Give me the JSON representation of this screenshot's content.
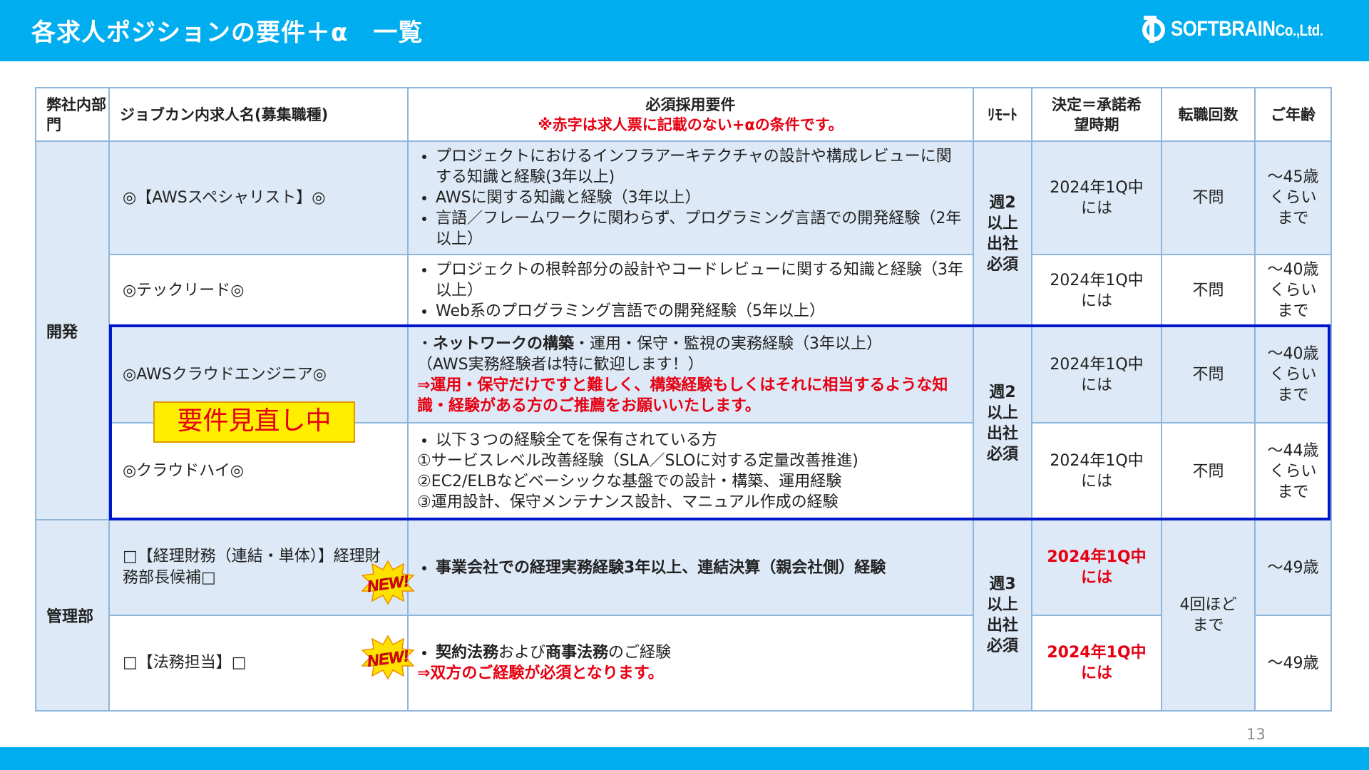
{
  "header": {
    "title": "各求人ポジションの要件＋α　一覧",
    "logo_text": "SOFTBRAIN",
    "logo_suffix": "Co.,Ltd."
  },
  "colors": {
    "brand": "#00aeef",
    "accent_red": "#e60012",
    "highlight_box": "#0018cc",
    "badge_yellow": "#ffee00",
    "row_blue": "#dde9f6"
  },
  "columns": {
    "dept": "弊社内部門",
    "job": "ジョブカン内求人名(募集職種)",
    "req_title": "必須採用要件",
    "req_note": "※赤字は求人票に記載のない+αの条件です。",
    "remote": "ﾘﾓｰﾄ",
    "timing": "決定＝承諾希望時期",
    "changes": "転職回数",
    "age": "ご年齢"
  },
  "depts": {
    "dev": "開発",
    "admin": "管理部"
  },
  "remote": {
    "g1": "週2以上出社必須",
    "g2": "週2以上出社必須",
    "g3": "週3以上出社必須"
  },
  "rows": [
    {
      "job": "◎【AWSスペシャリスト】◎",
      "req": [
        "プロジェクトにおけるインフラアーキテクチャの設計や構成レビューに関する知識と経験(3年以上)",
        "AWSに関する知識と経験（3年以上）",
        "言語／フレームワークに関わらず、プログラミング言語での開発経験（2年以上）"
      ],
      "timing": "2024年1Q中には",
      "changes": "不問",
      "age": "～45歳くらいまで"
    },
    {
      "job": "◎テックリード◎",
      "req": [
        "プロジェクトの根幹部分の設計やコードレビューに関する知識と経験（3年以上）",
        "Web系のプログラミング言語での開発経験（5年以上）"
      ],
      "timing": "2024年1Q中には",
      "changes": "不問",
      "age": "～40歳くらいまで"
    },
    {
      "job": "◎AWSクラウドエンジニア◎",
      "req_prefix": "・",
      "req_bold": "ネットワークの構築",
      "req_rest": "・運用・保守・監視の実務経験（3年以上）",
      "req_line2": "（AWS実務経験者は特に歓迎します！）",
      "req_red": "⇒運用・保守だけですと難しく、構築経験もしくはそれに相当するような知識・経験がある方のご推薦をお願いいたします。",
      "timing": "2024年1Q中には",
      "changes": "不問",
      "age": "～40歳くらいまで"
    },
    {
      "job": "◎クラウドハイ◎",
      "req_bullet": "以下３つの経験全てを保有されている方",
      "req_lines": [
        "①サービスレベル改善経験（SLA／SLOに対する定量改善推進)",
        "②EC2/ELBなどベーシックな基盤での設計・構築、運用経験",
        "③運用設計、保守メンテナンス設計、マニュアル作成の経験"
      ],
      "timing": "2024年1Q中には",
      "changes": "不問",
      "age": "～44歳くらいまで"
    },
    {
      "job": "□【経理財務（連結・単体）】経理財務部長候補□",
      "req_bold": "事業会社での経理実務経験3年以上、連結決算（親会社側）経験",
      "timing": "2024年1Q中には",
      "changes": "4回ほどまで",
      "age": "～49歳"
    },
    {
      "job": "□【法務担当】□",
      "req_b1": "契約法務",
      "req_t1": "および",
      "req_b2": "商事法務",
      "req_t2": "のご経験",
      "req_red": "⇒双方のご経験が必須となります。",
      "timing": "2024年1Q中には",
      "age": "～49歳"
    }
  ],
  "badges": {
    "review": "要件見直し中",
    "new": "NEW!"
  },
  "page_number": "13"
}
